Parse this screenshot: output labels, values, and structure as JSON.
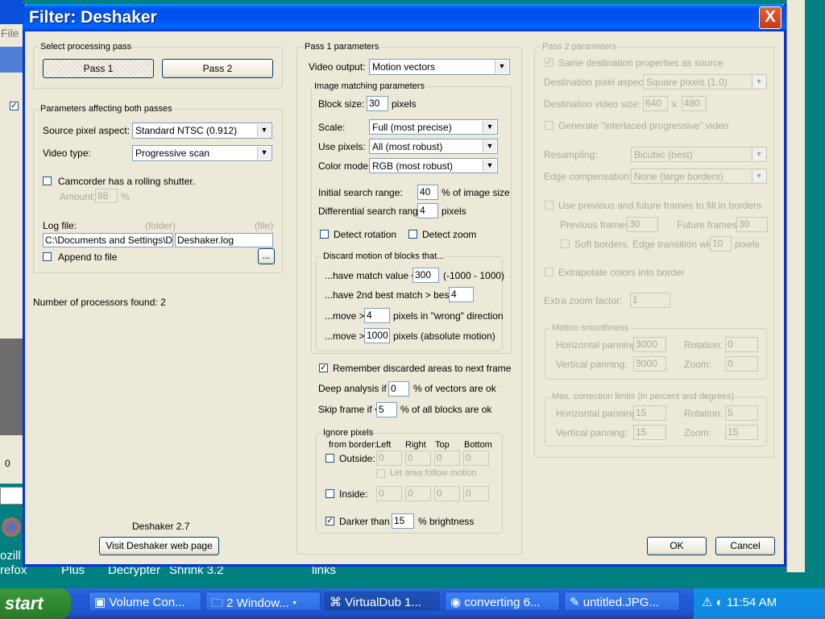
{
  "background": {
    "file_menu": "File",
    "desktop_labels": [
      "ozill",
      "refox",
      "Plus",
      "Decrypter",
      "Shrink 3.2",
      "links"
    ],
    "track_value": "0"
  },
  "taskbar": {
    "start": "start",
    "items": [
      "Volume Con...",
      "2 Window...",
      "VirtualDub 1...",
      "converting 6...",
      "untitled.JPG..."
    ],
    "clock": "11:54 AM"
  },
  "dialog": {
    "title": "Filter: Deshaker",
    "close": "X",
    "select_pass": {
      "label": "Select processing pass",
      "pass1": "Pass 1",
      "pass2": "Pass 2"
    },
    "both": {
      "label": "Parameters affecting both passes",
      "source_aspect_label": "Source pixel aspect:",
      "source_aspect_value": "Standard NTSC  (0.912)",
      "video_type_label": "Video type:",
      "video_type_value": "Progressive scan",
      "rolling_shutter": "Camcorder has a rolling shutter.",
      "amount_label": "Amount:",
      "amount_value": "88",
      "amount_unit": "%",
      "log_file_label": "Log file:",
      "folder_label": "(folder)",
      "file_label": "(file)",
      "folder_value": "C:\\Documents and Settings\\Dav",
      "file_value": "Deshaker.log",
      "append": "Append to file",
      "browse": "..."
    },
    "processors": "Number of processors found:  2",
    "version": "Deshaker 2.7",
    "visit": "Visit Deshaker web page",
    "pass1": {
      "label": "Pass 1 parameters",
      "video_output_label": "Video output:",
      "video_output_value": "Motion vectors",
      "img_label": "Image matching parameters",
      "block_size_label": "Block size:",
      "block_size_value": "30",
      "block_size_unit": "pixels",
      "scale_label": "Scale:",
      "scale_value": "Full  (most precise)",
      "use_pixels_label": "Use pixels:",
      "use_pixels_value": "All  (most robust)",
      "color_mode_label": "Color mode:",
      "color_mode_value": "RGB  (most robust)",
      "initial_label": "Initial search range:",
      "initial_value": "40",
      "initial_unit": "% of image size",
      "diff_label": "Differential search range:",
      "diff_value": "4",
      "diff_unit": "pixels",
      "detect_rotation": "Detect rotation",
      "detect_zoom": "Detect zoom",
      "discard_label": "Discard motion of blocks that...",
      "match_label": "...have match value <",
      "match_value": "300",
      "match_range": "(-1000 - 1000)",
      "second_label": "...have 2nd best match > best -",
      "second_value": "4",
      "move_label": "...move >",
      "move_value": "4",
      "move_unit": "pixels in \"wrong\" direction",
      "move2_value": "1000",
      "move2_unit": "pixels (absolute motion)",
      "remember": "Remember discarded areas to next frame",
      "deep_label": "Deep analysis if <",
      "deep_value": "0",
      "deep_unit": "% of vectors are ok",
      "skip_label": "Skip frame if <",
      "skip_value": "5",
      "skip_unit": "% of all blocks are ok",
      "ignore_label": "Ignore pixels",
      "from_border": "from border:",
      "left": "Left",
      "right": "Right",
      "top": "Top",
      "bottom": "Bottom",
      "outside": "Outside:",
      "outside_values": [
        "0",
        "0",
        "0",
        "0"
      ],
      "follow": "Let area follow motion",
      "inside": "Inside:",
      "inside_values": [
        "0",
        "0",
        "0",
        "0"
      ],
      "darker": "Darker than",
      "darker_value": "15",
      "darker_unit": "% brightness"
    },
    "pass2": {
      "label": "Pass 2 parameters",
      "same_dest": "Same destination properties as source",
      "dest_aspect_label": "Destination pixel aspect:",
      "dest_aspect_value": "Square pixels  (1.0)",
      "dest_size_label": "Destination video size:",
      "width": "640",
      "x": "x",
      "height": "480",
      "interlaced": "Generate \"interlaced progressive\" video",
      "resampling_label": "Resampling:",
      "resampling_value": "Bicubic  (best)",
      "edge_label": "Edge compensation:",
      "edge_value": "None  (large borders)",
      "use_prev": "Use previous and future frames to fill in borders",
      "prev_label": "Previous frames:",
      "prev_value": "30",
      "future_label": "Future frames:",
      "future_value": "30",
      "soft": "Soft borders. Edge transition width:",
      "soft_value": "10",
      "soft_unit": "pixels",
      "extrapolate": "Extrapolate colors into border",
      "extra_zoom_label": "Extra zoom factor:",
      "extra_zoom_value": "1",
      "smooth_label": "Motion smoothness",
      "h_pan_label": "Horizontal panning:",
      "h_pan_value": "3000",
      "rot_label": "Rotation:",
      "rot_value": "0",
      "v_pan_label": "Vertical panning:",
      "v_pan_value": "3000",
      "zoom_label": "Zoom:",
      "zoom_value": "0",
      "max_label": "Max. correction limits (in percent and degrees)",
      "mh_pan_value": "15",
      "mrot_value": "5",
      "mv_pan_value": "15",
      "mzoom_value": "15"
    },
    "ok": "OK",
    "cancel": "Cancel"
  }
}
